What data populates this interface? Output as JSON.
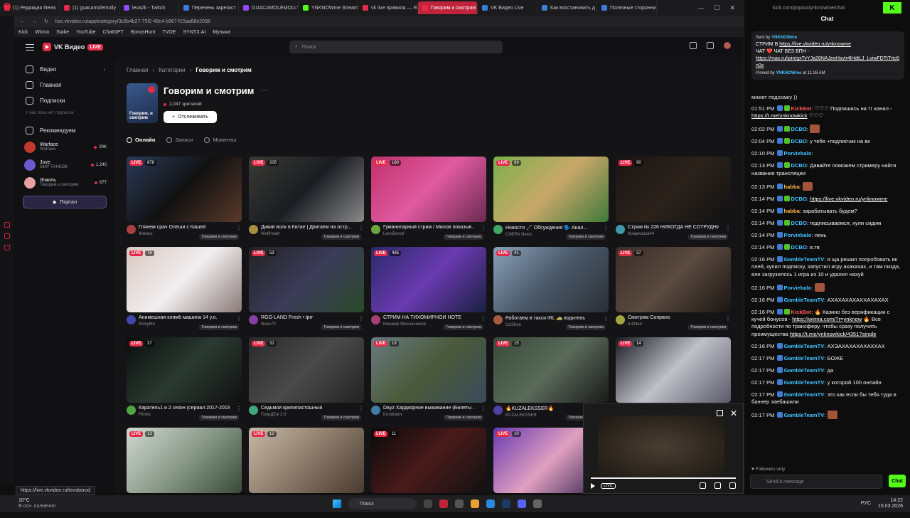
{
  "browser": {
    "tabs": [
      {
        "label": "(1) Редакция News",
        "color": "#e52a48",
        "active": false
      },
      {
        "label": "(1) guacamolemolly",
        "color": "#e52a48",
        "active": false
      },
      {
        "label": "leva2k - Twitch",
        "color": "#9146ff",
        "active": false
      },
      {
        "label": "Перечень зарегист",
        "color": "#3b7dd8",
        "active": false
      },
      {
        "label": "GUACAMOLEMOLLY",
        "color": "#9146ff",
        "active": false
      },
      {
        "label": "YNKNOWme Stream",
        "color": "#53fc18",
        "active": false
      },
      {
        "label": "vk live правила — R",
        "color": "#e52a48",
        "active": false
      },
      {
        "label": "Говорим и смотрим — V",
        "color": "#e52a48",
        "active": true
      },
      {
        "label": "VK Видео Live",
        "color": "#3b7dd8",
        "active": false
      },
      {
        "label": "Как восстановить д",
        "color": "#3b7dd8",
        "active": false
      },
      {
        "label": "Полезные сторонни",
        "color": "#3b7dd8",
        "active": false
      }
    ],
    "url": "live.vkvideo.ru/app/category/3c6b4b27-75f2-49c4-b967-f15aa88e2038",
    "bookmarks": [
      "Kick",
      "Winna",
      "Stake",
      "YouTube",
      "ChatGPT",
      "BonusHunt",
      "TVOE",
      "SYNTX.AI",
      "Музыка"
    ],
    "status_url": "https://live.vkvideo.ru/levoborod"
  },
  "app": {
    "logo": "VK Видео",
    "logo_badge": "LIVE",
    "search_placeholder": "Поиск",
    "sidebar": {
      "nav": [
        {
          "label": "Видео",
          "icon": "play-icon"
        },
        {
          "label": "Главная",
          "icon": "home-icon"
        },
        {
          "label": "Подписки",
          "icon": "subscriptions-icon"
        }
      ],
      "subs_hint": "У вас пока нет подписок",
      "recommended": "Рекомендуем",
      "channels": [
        {
          "name": "Warface",
          "sub": "Warface",
          "count": "20K",
          "color": "#c0392b"
        },
        {
          "name": "Jove",
          "sub": "МИР ТАНКОВ",
          "count": "1,240",
          "color": "#6a5acd"
        },
        {
          "name": "Жмиль",
          "sub": "Говорим и смотрим",
          "count": "677",
          "color": "#e8a0a0"
        }
      ],
      "portal": "Портал"
    },
    "breadcrumb": [
      "Главная",
      "Категории",
      "Говорим и смотрим"
    ],
    "category": {
      "title": "Говорим и смотрим",
      "viewers": "2,047 зрителей",
      "follow": "Отслеживать",
      "img_label": "Говорим, и смотрим"
    },
    "subtabs": [
      "Онлайн",
      "Записи",
      "Моменты"
    ],
    "streams": [
      {
        "title": "Глянем срач Олеши с Кашей",
        "author": "Жмиль",
        "cat": "Говорим и смотрим",
        "viewers": "878",
        "bg": "linear-gradient(135deg,#2a3b5a,#111,#5a3a2a)"
      },
      {
        "title": "Дикий волк в Китае | Двигаем на остр...",
        "author": "WolfHeart",
        "cat": "Говорим и смотрим",
        "viewers": "205",
        "bg": "linear-gradient(135deg,#3a3a34,#1a1d22,#888)"
      },
      {
        "title": "Гуманитарный стрим / Милов показыв...",
        "author": "LevoBorod",
        "cat": "Говорим и смотрим",
        "viewers": "180",
        "bg": "linear-gradient(135deg,#c0306a,#e05aa0,#6a2a50)"
      },
      {
        "title": "Новости 🖋️ Обсуждения 🗣️ Анал...",
        "author": "СФЕРА News",
        "cat": "Говорим и смотрим",
        "viewers": "99",
        "bg": "linear-gradient(135deg,#7ab04a,#c9a86a,#3f7a3a)"
      },
      {
        "title": "Стрим № 226 НИКОГДА НЕ СОТРУДНИ...",
        "author": "Кощеюшка44",
        "cat": "Говорим и смотрим",
        "viewers": "90",
        "bg": "linear-gradient(135deg,#1a1512,#2b221b,#111)"
      },
      {
        "title": "Анимешная климб машина 14 у.о.",
        "author": "KlimyMe",
        "cat": "Говорим и смотрим",
        "viewers": "76",
        "bg": "linear-gradient(135deg,#d8c8c0,#f2eef0,#8a7a78)"
      },
      {
        "title": "RGG-LAND Fresh • lprr",
        "author": "Nuke73",
        "cat": "Говорим и смотрим",
        "viewers": "53",
        "bg": "linear-gradient(135deg,#222,#3b3b5a,#2a4a2a)"
      },
      {
        "title": "СТРИМ НА ТИХОМИРНОЙ НОТЕ",
        "author": "Кошмар Мошенников",
        "cat": "Говорим и смотрим",
        "viewers": "435",
        "bg": "linear-gradient(135deg,#2a2a6a,#6a3ab0,#1a2040)"
      },
      {
        "title": "Работаем в такси IRL 🚕 водитель",
        "author": "OuShen",
        "cat": "Говорим и смотрим",
        "viewers": "41",
        "bg": "linear-gradient(135deg,#8aa0b8,#4a5868,#2a2f36)"
      },
      {
        "title": "Смотрим Сопрано",
        "author": "m1hten",
        "cat": "Говорим и смотрим",
        "viewers": "37",
        "bg": "linear-gradient(135deg,#3a2e28,#5a4a40,#1a1512)"
      },
      {
        "title": "Каратель1 и 2 сезон (сериал 2017-2019)",
        "author": "Flintra",
        "cat": "Говорим и смотрим",
        "viewers": "37",
        "bg": "linear-gradient(135deg,#0a0d0c,#2a3a32,#111)"
      },
      {
        "title": "Седьмой крипипастошный",
        "author": "ТринДЕж 2.0",
        "cat": "Говорим и смотрим",
        "viewers": "31",
        "bg": "linear-gradient(135deg,#2a2a2a,#4a4a4a,#222)"
      },
      {
        "title": "Dayz Хардкорное выживание (Билеты ...",
        "author": "Kondratov",
        "cat": "Говорим и смотрим",
        "viewers": "19",
        "bg": "linear-gradient(135deg,#6a7a80,#4a5a3a,#3a4a5a)"
      },
      {
        "title": "🔥KUZALEKSSER🔥",
        "author": "KUZALEKSSER",
        "cat": "Говорим и смотрим",
        "viewers": "15",
        "bg": "linear-gradient(135deg,#3a4a3a,#5a6a5a,#1a1a1a)"
      },
      {
        "title": "",
        "author": "",
        "cat": "",
        "viewers": "14",
        "bg": "linear-gradient(135deg,#1a1a24,#c0c0c8,#5a5a6a)"
      },
      {
        "title": "",
        "author": "",
        "cat": "",
        "viewers": "13",
        "bg": "linear-gradient(135deg,#d0d8d0,#8a9a8a,#3a4a3a)"
      },
      {
        "title": "",
        "author": "",
        "cat": "",
        "viewers": "12",
        "bg": "linear-gradient(135deg,#c8b8a8,#8a7a6a,#4a3a30)"
      },
      {
        "title": "",
        "author": "",
        "cat": "",
        "viewers": "11",
        "bg": "linear-gradient(135deg,#0a0a0a,#4a1a1a,#111)"
      },
      {
        "title": "",
        "author": "",
        "cat": "",
        "viewers": "10",
        "bg": "linear-gradient(135deg,#6a3ab0,#e0a0c0,#2a1a4a)"
      }
    ],
    "pip": {
      "live": "LIVE"
    }
  },
  "chat": {
    "url": "kick.com/popout/ynknowme/chat",
    "title": "Chat",
    "pinned": {
      "sent_by": "Sent by",
      "user": "YNKNOWme",
      "line1_prefix": "СТРИМ В",
      "line1_link": "https://live.vkvideo.ru/ynknowme",
      "line2": "ЧАТ ❤️ ЧАТ БЕЗ ВПН -",
      "line3_link": "https://max.ru/join/gxTyYJa28NAJeeHsvlr4lHdtLJ_LviwFDTtTrto5n0s",
      "pinned_by": "Pinned by",
      "pinned_user": "YNKNOWme",
      "pinned_at": "at 11:26 AM",
      "trail": "может подскажу ))"
    },
    "messages": [
      {
        "time": "01:51 PM",
        "user": "KickBot",
        "ucls": "u-red",
        "text": "♡♡♡ Подпишись на тг канал - ",
        "link": "https://t.me/ynknowkick",
        "after": " ♡♡♡"
      },
      {
        "time": "02:02 PM",
        "user": "DCBO",
        "ucls": "u-cyan",
        "text": "",
        "emote": true
      },
      {
        "time": "02:04 PM",
        "user": "DCBO",
        "ucls": "u-cyan",
        "text": "у тебя +подписчик на вк"
      },
      {
        "time": "02:10 PM",
        "user": "Porviebalo",
        "ucls": "u-cyan",
        "text": ""
      },
      {
        "time": "02:13 PM",
        "user": "DCBO",
        "ucls": "u-cyan",
        "text": "Давайте поможем стримеру найти название трансляции"
      },
      {
        "time": "02:13 PM",
        "user": "habba",
        "ucls": "u-orange",
        "text": "",
        "emote": true
      },
      {
        "time": "02:14 PM",
        "user": "DCBO",
        "ucls": "u-cyan",
        "text": "",
        "link": "https://live.vkvideo.ru/ynknowme"
      },
      {
        "time": "02:14 PM",
        "user": "habba",
        "ucls": "u-orange",
        "text": "зарабатывать будем?"
      },
      {
        "time": "02:14 PM",
        "user": "DCBO",
        "ucls": "u-cyan",
        "text": "подписываемся, хули сидим"
      },
      {
        "time": "02:14 PM",
        "user": "Porviebalo",
        "ucls": "u-cyan",
        "text": "лень"
      },
      {
        "time": "02:14 PM",
        "user": "DCBO",
        "ucls": "u-cyan",
        "text": "в.тв"
      },
      {
        "time": "02:16 PM",
        "user": "GambleTeamTV",
        "ucls": "u-cyan",
        "text": "я ща решил попробовать вк плей, купил подписку, запустил игру ахахахах, и там пизда, еле загрузилось 1 игра из 10 и удалил нахуй"
      },
      {
        "time": "02:16 PM",
        "user": "Porviebalo",
        "ucls": "u-cyan",
        "text": "",
        "emote": true
      },
      {
        "time": "02:16 PM",
        "user": "GambleTeamTV",
        "ucls": "u-cyan",
        "text": "АХАХАХАХАХХАХАХАХ"
      },
      {
        "time": "02:16 PM",
        "user": "KickBot",
        "ucls": "u-red",
        "text": "🔥 Казино без верификации с кучей бонусов - ",
        "link": "https://winna.com/?r=ynknow",
        "after": " 🔥 Все подробности по трансферу, чтобы сразу получить преимущества ",
        "link2": "https://t.me/ynknowkick/4351?single"
      },
      {
        "time": "02:16 PM",
        "user": "GambleTeamTV",
        "ucls": "u-cyan",
        "text": "АХЭАХАХАХАХАХХАХ"
      },
      {
        "time": "02:17 PM",
        "user": "GambleTeamTV",
        "ucls": "u-cyan",
        "text": "БОЖЕ"
      },
      {
        "time": "02:17 PM",
        "user": "GambleTeamTV",
        "ucls": "u-cyan",
        "text": "да"
      },
      {
        "time": "02:17 PM",
        "user": "GambleTeamTV",
        "ucls": "u-cyan",
        "text": "у которой 100 онлайн"
      },
      {
        "time": "02:17 PM",
        "user": "GambleTeamTV",
        "ucls": "u-cyan",
        "text": "это как если бы тебя туда в баннер заебашили"
      },
      {
        "time": "02:17 PM",
        "user": "GambleTeamTV",
        "ucls": "u-cyan",
        "text": "",
        "emote": true
      }
    ],
    "followers_only": "Followers only",
    "input_placeholder": "Send a message",
    "chat_button": "Chat"
  },
  "taskbar": {
    "weather_temp": "10°C",
    "weather_desc": "В осн. солнечно",
    "search": "Поиск",
    "lang": "РУС",
    "time": "14:22",
    "date": "15.03.2026"
  }
}
